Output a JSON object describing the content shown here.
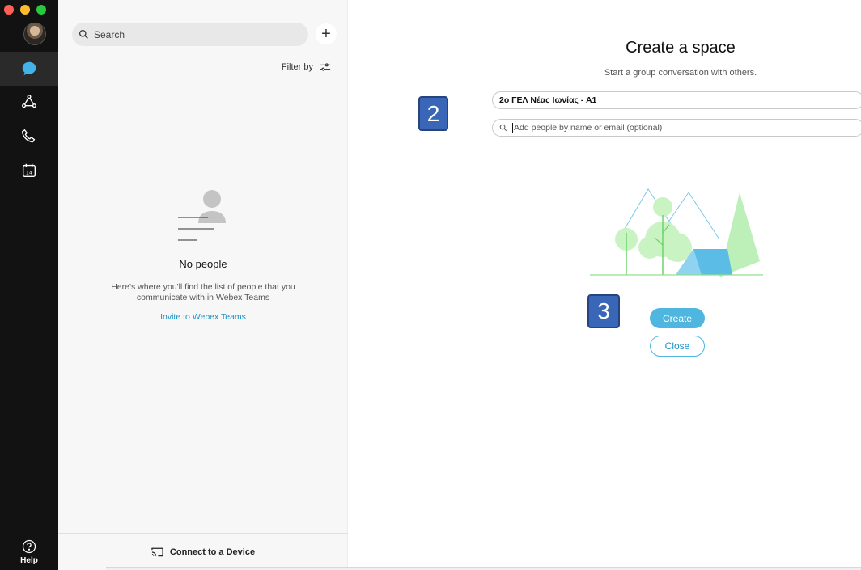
{
  "nav": {
    "help_label": "Help",
    "items": [
      {
        "icon": "chat-bubble-icon",
        "active": true
      },
      {
        "icon": "teams-icon",
        "active": false
      },
      {
        "icon": "phone-icon",
        "active": false
      },
      {
        "icon": "calendar-icon",
        "active": false,
        "date": "14"
      }
    ]
  },
  "people_panel": {
    "search_placeholder": "Search",
    "filter_label": "Filter by",
    "empty_title": "No people",
    "empty_description": "Here's where you'll find the list of people that you communicate with in Webex Teams",
    "invite_link": "Invite to Webex Teams",
    "connect_label": "Connect to a Device"
  },
  "create_space": {
    "title": "Create a space",
    "subtitle": "Start a group conversation with others.",
    "space_name_value": "2ο ΓΕΛ Νέας Ιωνίας - Α1",
    "add_people_placeholder": "Add people by name or email (optional)",
    "create_label": "Create",
    "close_label": "Close"
  },
  "annotations": {
    "step_2": "2",
    "step_3": "3"
  },
  "colors": {
    "rail_bg": "#121212",
    "accent": "#4fb6e0",
    "link": "#1a91c7",
    "badge": "#3a66b8"
  }
}
